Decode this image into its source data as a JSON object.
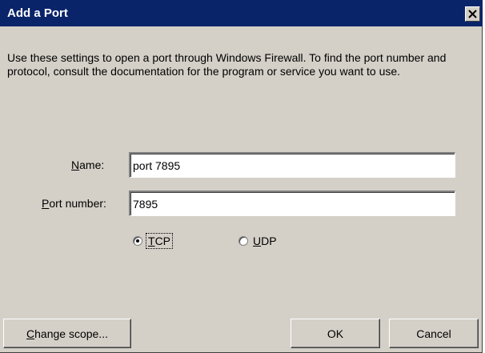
{
  "dialog": {
    "title": "Add a Port",
    "close_glyph": "✕",
    "description": "Use these settings to open a port through Windows Firewall. To find the port number and protocol, consult the documentation for the program or service you want to use."
  },
  "form": {
    "name": {
      "label_accel": "N",
      "label_rest": "ame:",
      "value": "port 7895"
    },
    "port": {
      "label_accel": "P",
      "label_rest": "ort number:",
      "value": "7895"
    },
    "protocols": [
      {
        "accel": "T",
        "rest": "CP",
        "selected": true
      },
      {
        "accel": "U",
        "rest": "DP",
        "selected": false
      }
    ]
  },
  "buttons": {
    "change_scope_accel": "C",
    "change_scope_rest": "hange scope...",
    "ok": "OK",
    "cancel": "Cancel"
  },
  "colors": {
    "titlebar": "#0a246a",
    "face": "#d4d0c8"
  },
  "icons": {
    "close": "close-icon"
  }
}
